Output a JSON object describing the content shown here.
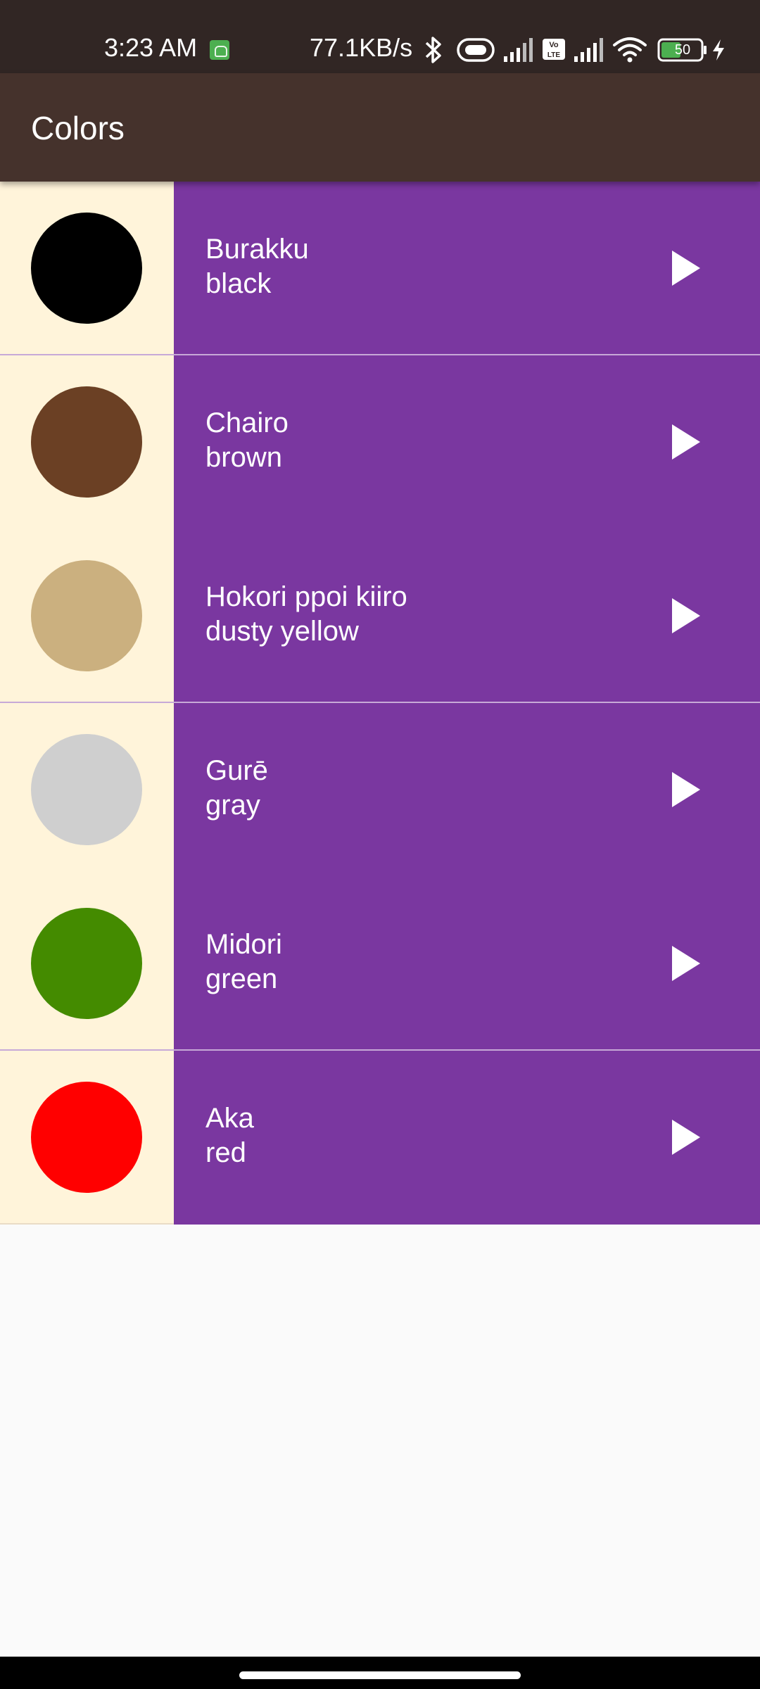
{
  "status_bar": {
    "time": "3:23 AM",
    "network_speed": "77.1KB/s",
    "volte_label": "Vo LTE",
    "battery_level": "50",
    "icons": [
      "app-notification-icon",
      "bluetooth-icon",
      "vibrate-icon",
      "signal-icon",
      "volte-icon",
      "signal-icon",
      "wifi-icon",
      "battery-icon",
      "charging-icon"
    ]
  },
  "app_bar": {
    "title": "Colors"
  },
  "colors": [
    {
      "japanese": "Burakku",
      "english": "black",
      "swatch": "#000000"
    },
    {
      "japanese": "Chairo",
      "english": "brown",
      "swatch": "#6b4024"
    },
    {
      "japanese": "Hokori ppoi kiiro",
      "english": "dusty yellow",
      "swatch": "#cbb07f"
    },
    {
      "japanese": "Gurē",
      "english": "gray",
      "swatch": "#cfcfcf"
    },
    {
      "japanese": "Midori",
      "english": "green",
      "swatch": "#448b00"
    },
    {
      "japanese": "Aka",
      "english": "red",
      "swatch": "#ff0000"
    }
  ],
  "theme": {
    "status_bar": "#312624",
    "app_bar": "#45322c",
    "row_background": "#7a37a0",
    "swatch_cell": "#fff4da",
    "page_background": "#fafafa"
  },
  "item_action_icon": "play-arrow-icon"
}
